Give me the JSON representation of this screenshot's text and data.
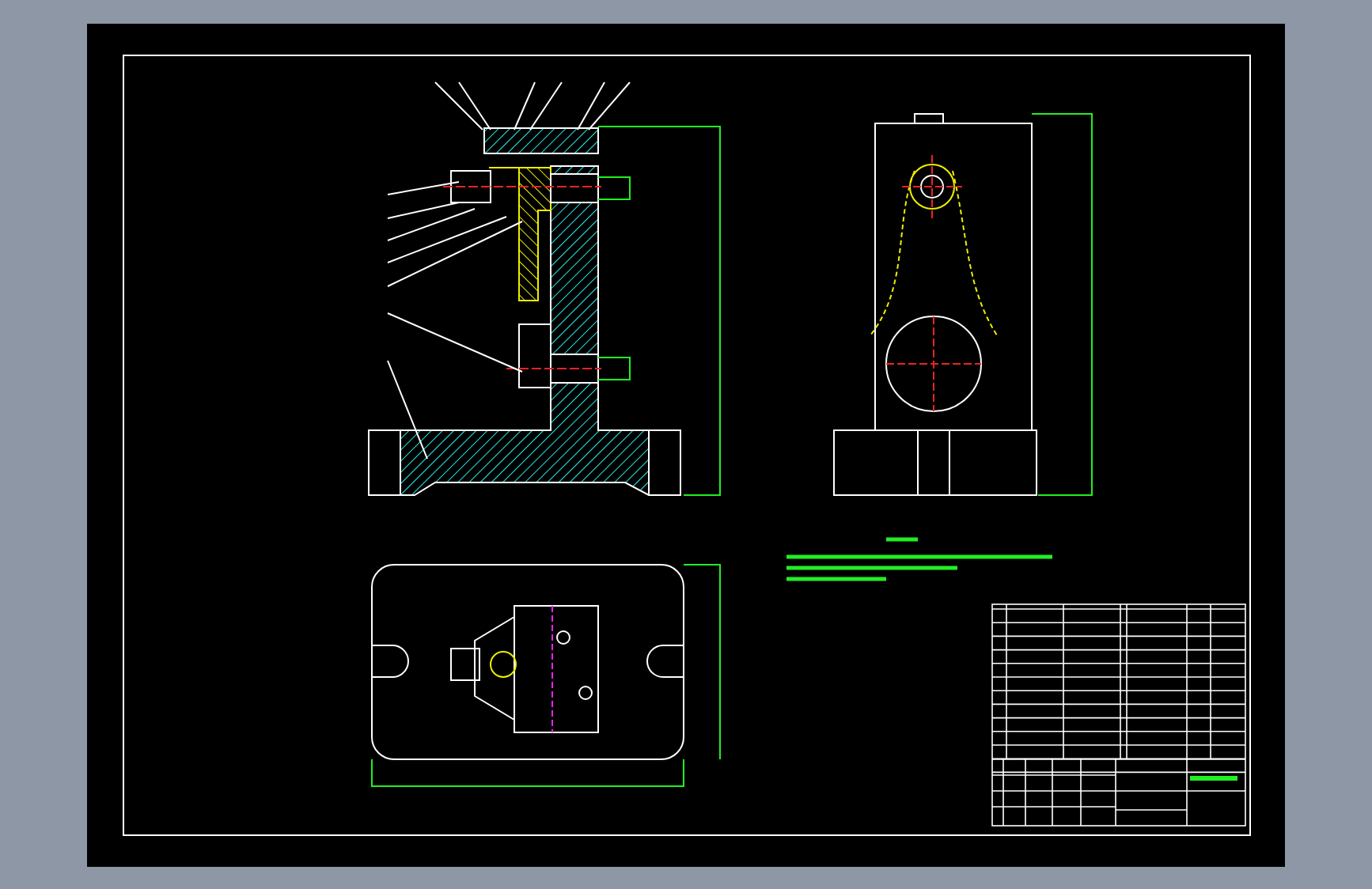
{
  "sheet": {
    "views": [
      {
        "kind": "section"
      },
      {
        "kind": "side"
      },
      {
        "kind": "plan"
      },
      {
        "kind": "notes"
      },
      {
        "kind": "titleblock"
      }
    ]
  }
}
